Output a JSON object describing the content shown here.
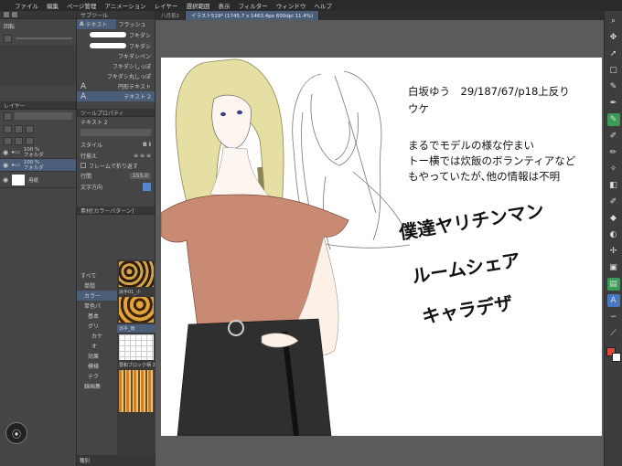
{
  "menubar": {
    "items": [
      "ファイル",
      "編集",
      "ページ管理",
      "アニメーション",
      "レイヤー",
      "選択範囲",
      "表示",
      "フィルター",
      "ウィンドウ",
      "ヘルプ"
    ]
  },
  "left_panel": {
    "nav_label": "回転",
    "layer_header": "レイヤー",
    "layers": [
      {
        "opacity": "100 %",
        "name": "フォルダ"
      },
      {
        "opacity": "100 %",
        "name": "フォルダ"
      },
      {
        "opacity": "",
        "name": "用紙"
      }
    ]
  },
  "mid_panel": {
    "subtool_header": "サブツール",
    "tabs": [
      "テキスト",
      "フラッシュ"
    ],
    "subtools": [
      "フキダシ",
      "フキダシ",
      "フキダシペン",
      "フキダシしっぽ",
      "フキダシ丸しっぽ",
      "円形テキスト",
      "テキスト 2"
    ],
    "tool_property_header": "ツールプロパティ",
    "tool_property_name": "テキスト 2",
    "props": [
      {
        "label": "スタイル",
        "value": "B I"
      },
      {
        "label": "行揃え",
        "value": ""
      },
      {
        "label": "フレームで折り返す",
        "value": ""
      },
      {
        "label": "行間",
        "value": "155.0"
      },
      {
        "label": "文字方向",
        "value": ""
      }
    ],
    "material_header": "素材[カラーパターン]",
    "material_tree": [
      "すべて",
      "単階",
      "カラー",
      "単色パ",
      "基本",
      "グリ",
      "カケ",
      "オ",
      "効果",
      "模様",
      "テク",
      "線画集"
    ],
    "material_names": [
      "派手01_小",
      "派手_雨",
      "豊和ブロック柄 2"
    ],
    "bottom_label": "種別"
  },
  "canvas_tabs": [
    "八月祭2",
    "イラスト519* (1745.7 x 1463.4px 600dpi 11.4%)"
  ],
  "canvas": {
    "note_line1": "白坂ゆう　29/187/67/p18上反り",
    "note_line2": "ウケ",
    "desc_line1": "まるでモデルの様な佇まい",
    "desc_line2": "トー横では炊飯のボランティアなど",
    "desc_line3": "もやっていたが､他の情報は不明",
    "title_line1": "僕達ヤリチンマン",
    "title_line2": "ルームシェア",
    "title_line3": "キャラデザ"
  },
  "right_toolbar": {
    "icons": [
      "zoom-icon",
      "move-icon",
      "select-icon",
      "lasso-icon",
      "eyedropper-icon",
      "pen-icon",
      "pencil-icon",
      "brush-icon",
      "airbrush-icon",
      "decoration-icon",
      "eraser-icon",
      "blend-icon",
      "fill-icon",
      "gradient-icon",
      "figure-icon",
      "frame-icon",
      "text-icon",
      "balloon-icon",
      "line-fix-icon",
      "color-swatch-icon"
    ]
  },
  "colors": {
    "accent": "#4a78c0",
    "green_tool": "#3b9a55",
    "top_color": "#d94b3c",
    "blouse": "#c98a74",
    "skirt": "#2f2f2f",
    "hair": "#e6dfa4"
  }
}
